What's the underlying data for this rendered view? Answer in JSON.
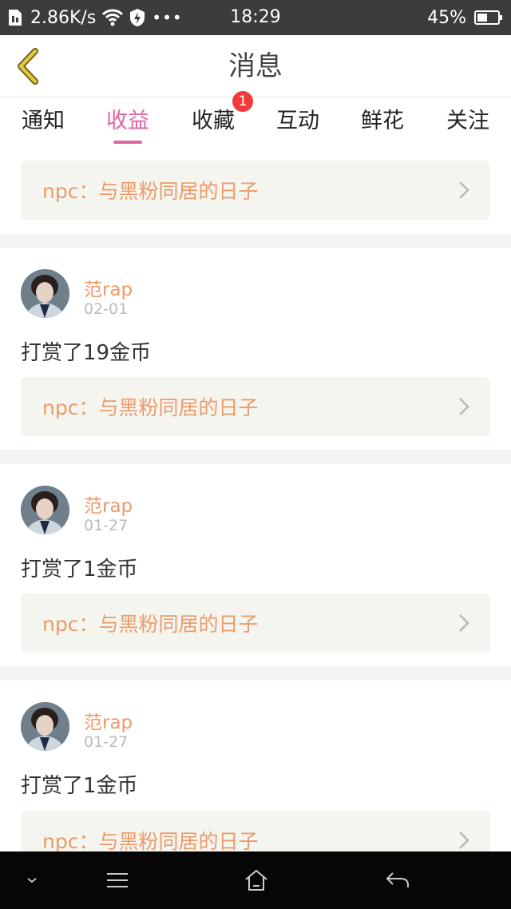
{
  "status_bar": {
    "speed": "2.86K/s",
    "dots": "•••",
    "time": "18:29",
    "battery": "45%"
  },
  "header": {
    "title": "消息"
  },
  "tabs": [
    {
      "label": "通知",
      "active": false
    },
    {
      "label": "收益",
      "active": true
    },
    {
      "label": "收藏",
      "active": false,
      "badge": "1"
    },
    {
      "label": "互动",
      "active": false
    },
    {
      "label": "鲜花",
      "active": false
    },
    {
      "label": "关注",
      "active": false
    }
  ],
  "first_item": {
    "book": "npc：与黑粉同居的日子"
  },
  "items": [
    {
      "user": "范rap",
      "date": "02-01",
      "action": "打赏了19金币",
      "book": "npc：与黑粉同居的日子"
    },
    {
      "user": "范rap",
      "date": "01-27",
      "action": "打赏了1金币",
      "book": "npc：与黑粉同居的日子"
    },
    {
      "user": "范rap",
      "date": "01-27",
      "action": "打赏了1金币",
      "book": "npc：与黑粉同居的日子"
    }
  ],
  "colors": {
    "accent_pink": "#e2659f",
    "book_orange": "#ec9b6a",
    "badge_red": "#f23b3b",
    "back_yellow": "#e0c73c"
  }
}
